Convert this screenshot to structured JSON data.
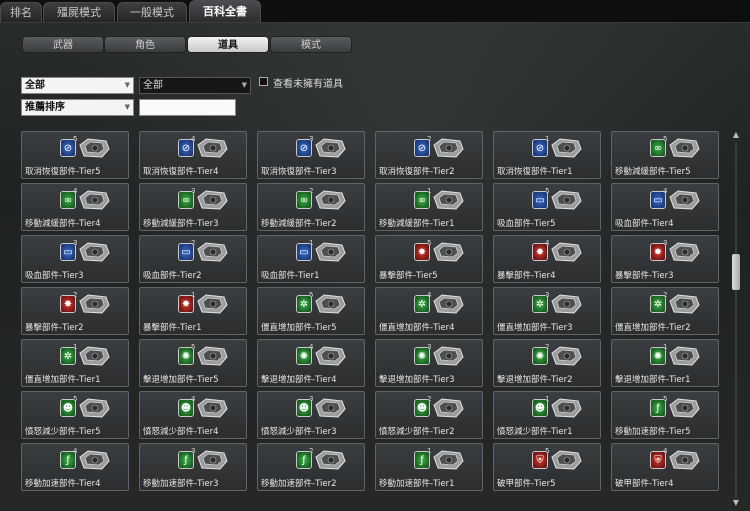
{
  "top_tabs": [
    {
      "label": "排名",
      "active": false
    },
    {
      "label": "殭屍模式",
      "active": false
    },
    {
      "label": "一般模式",
      "active": false
    },
    {
      "label": "百科全書",
      "active": true
    }
  ],
  "sub_tabs": [
    {
      "label": "武器",
      "active": false
    },
    {
      "label": "角色",
      "active": false
    },
    {
      "label": "道具",
      "active": true
    },
    {
      "label": "模式",
      "active": false
    }
  ],
  "filters": {
    "category_1": "全部",
    "category_2": "全部",
    "sort": "推薦排序",
    "search_value": "",
    "show_unowned_label": "查看未擁有道具"
  },
  "items": [
    {
      "name": "取消恢復部件-Tier5",
      "tier": "5",
      "color": "blue",
      "icon": "recovery-cancel-icon"
    },
    {
      "name": "取消恢復部件-Tier4",
      "tier": "4",
      "color": "blue",
      "icon": "recovery-cancel-icon"
    },
    {
      "name": "取消恢復部件-Tier3",
      "tier": "3",
      "color": "blue",
      "icon": "recovery-cancel-icon"
    },
    {
      "name": "取消恢復部件-Tier2",
      "tier": "2",
      "color": "blue",
      "icon": "recovery-cancel-icon"
    },
    {
      "name": "取消恢復部件-Tier1",
      "tier": "1",
      "color": "blue",
      "icon": "recovery-cancel-icon"
    },
    {
      "name": "移動減緩部件-Tier5",
      "tier": "5",
      "color": "green",
      "icon": "chain-icon"
    },
    {
      "name": "移動減緩部件-Tier4",
      "tier": "4",
      "color": "green",
      "icon": "chain-icon"
    },
    {
      "name": "移動減緩部件-Tier3",
      "tier": "3",
      "color": "green",
      "icon": "chain-icon"
    },
    {
      "name": "移動減緩部件-Tier2",
      "tier": "2",
      "color": "green",
      "icon": "chain-icon"
    },
    {
      "name": "移動減緩部件-Tier1",
      "tier": "1",
      "color": "green",
      "icon": "chain-icon"
    },
    {
      "name": "吸血部件-Tier5",
      "tier": "5",
      "color": "blue",
      "icon": "vampire-icon"
    },
    {
      "name": "吸血部件-Tier4",
      "tier": "4",
      "color": "blue",
      "icon": "vampire-icon"
    },
    {
      "name": "吸血部件-Tier3",
      "tier": "3",
      "color": "blue",
      "icon": "vampire-icon"
    },
    {
      "name": "吸血部件-Tier2",
      "tier": "2",
      "color": "blue",
      "icon": "vampire-icon"
    },
    {
      "name": "吸血部件-Tier1",
      "tier": "1",
      "color": "blue",
      "icon": "vampire-icon"
    },
    {
      "name": "暴擊部件-Tier5",
      "tier": "5",
      "color": "red",
      "icon": "critical-burst-icon"
    },
    {
      "name": "暴擊部件-Tier4",
      "tier": "4",
      "color": "red",
      "icon": "critical-burst-icon"
    },
    {
      "name": "暴擊部件-Tier3",
      "tier": "3",
      "color": "red",
      "icon": "critical-burst-icon"
    },
    {
      "name": "暴擊部件-Tier2",
      "tier": "2",
      "color": "red",
      "icon": "critical-burst-icon"
    },
    {
      "name": "暴擊部件-Tier1",
      "tier": "1",
      "color": "red",
      "icon": "critical-burst-icon"
    },
    {
      "name": "僵直增加部件-Tier5",
      "tier": "5",
      "color": "green",
      "icon": "stun-icon"
    },
    {
      "name": "僵直增加部件-Tier4",
      "tier": "4",
      "color": "green",
      "icon": "stun-icon"
    },
    {
      "name": "僵直增加部件-Tier3",
      "tier": "3",
      "color": "green",
      "icon": "stun-icon"
    },
    {
      "name": "僵直增加部件-Tier2",
      "tier": "2",
      "color": "green",
      "icon": "stun-icon"
    },
    {
      "name": "僵直增加部件-Tier1",
      "tier": "1",
      "color": "green",
      "icon": "stun-icon"
    },
    {
      "name": "擊退增加部件-Tier5",
      "tier": "5",
      "color": "green",
      "icon": "knockback-icon"
    },
    {
      "name": "擊退增加部件-Tier4",
      "tier": "4",
      "color": "green",
      "icon": "knockback-icon"
    },
    {
      "name": "擊退增加部件-Tier3",
      "tier": "3",
      "color": "green",
      "icon": "knockback-icon"
    },
    {
      "name": "擊退增加部件-Tier2",
      "tier": "2",
      "color": "green",
      "icon": "knockback-icon"
    },
    {
      "name": "擊退增加部件-Tier1",
      "tier": "1",
      "color": "green",
      "icon": "knockback-icon"
    },
    {
      "name": "憤怒減少部件-Tier5",
      "tier": "5",
      "color": "green",
      "icon": "rage-icon"
    },
    {
      "name": "憤怒減少部件-Tier4",
      "tier": "4",
      "color": "green",
      "icon": "rage-icon"
    },
    {
      "name": "憤怒減少部件-Tier3",
      "tier": "3",
      "color": "green",
      "icon": "rage-icon"
    },
    {
      "name": "憤怒減少部件-Tier2",
      "tier": "2",
      "color": "green",
      "icon": "rage-icon"
    },
    {
      "name": "憤怒減少部件-Tier1",
      "tier": "1",
      "color": "green",
      "icon": "rage-icon"
    },
    {
      "name": "移動加速部件-Tier5",
      "tier": "5",
      "color": "green",
      "icon": "speed-boot-icon"
    },
    {
      "name": "移動加速部件-Tier4",
      "tier": "4",
      "color": "green",
      "icon": "speed-boot-icon"
    },
    {
      "name": "移動加速部件-Tier3",
      "tier": "3",
      "color": "green",
      "icon": "speed-boot-icon"
    },
    {
      "name": "移動加速部件-Tier2",
      "tier": "2",
      "color": "green",
      "icon": "speed-boot-icon"
    },
    {
      "name": "移動加速部件-Tier1",
      "tier": "1",
      "color": "green",
      "icon": "speed-boot-icon"
    },
    {
      "name": "破甲部件-Tier5",
      "tier": "5",
      "color": "red",
      "icon": "armor-break-icon"
    },
    {
      "name": "破甲部件-Tier4",
      "tier": "4",
      "color": "red",
      "icon": "armor-break-icon"
    }
  ],
  "icon_glyphs": {
    "recovery-cancel-icon": "⊘",
    "chain-icon": "∞",
    "vampire-icon": "▭",
    "critical-burst-icon": "✸",
    "stun-icon": "✲",
    "knockback-icon": "✺",
    "rage-icon": "☻",
    "speed-boot-icon": "ƒ",
    "armor-break-icon": "⛨"
  },
  "scroll_position": 0.35
}
